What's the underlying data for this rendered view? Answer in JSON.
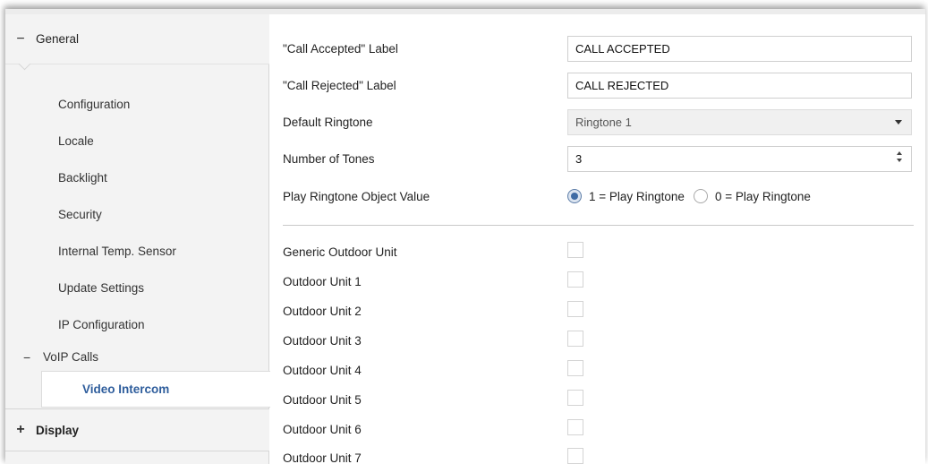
{
  "sidebar": {
    "general": {
      "symbol": "−",
      "label": "General"
    },
    "items": [
      {
        "label": "Configuration"
      },
      {
        "label": "Locale"
      },
      {
        "label": "Backlight"
      },
      {
        "label": "Security"
      },
      {
        "label": "Internal Temp. Sensor"
      },
      {
        "label": "Update Settings"
      },
      {
        "label": "IP Configuration"
      }
    ],
    "voip": {
      "symbol": "−",
      "label": "VoIP Calls"
    },
    "active": {
      "label": "Video Intercom"
    },
    "display": {
      "symbol": "+",
      "label": "Display"
    }
  },
  "form": {
    "call_accepted": {
      "label": "\"Call Accepted\" Label",
      "value": "CALL ACCEPTED"
    },
    "call_rejected": {
      "label": "\"Call Rejected\" Label",
      "value": "CALL REJECTED"
    },
    "default_ringtone": {
      "label": "Default Ringtone",
      "value": "Ringtone 1"
    },
    "number_of_tones": {
      "label": "Number of Tones",
      "value": "3"
    },
    "play_ringtone": {
      "label": "Play Ringtone Object Value",
      "options": [
        "1 = Play Ringtone",
        "0 = Play Ringtone"
      ],
      "selected": 0
    },
    "outdoor_units": [
      {
        "label": "Generic Outdoor Unit",
        "checked": false
      },
      {
        "label": "Outdoor Unit 1",
        "checked": false
      },
      {
        "label": "Outdoor Unit 2",
        "checked": false
      },
      {
        "label": "Outdoor Unit 3",
        "checked": false
      },
      {
        "label": "Outdoor Unit 4",
        "checked": false
      },
      {
        "label": "Outdoor Unit 5",
        "checked": false
      },
      {
        "label": "Outdoor Unit 6",
        "checked": false
      },
      {
        "label": "Outdoor Unit 7",
        "checked": false
      }
    ]
  },
  "colors": {
    "accent": "#2e5d9c",
    "radio_selected": "#3f6ba4"
  }
}
